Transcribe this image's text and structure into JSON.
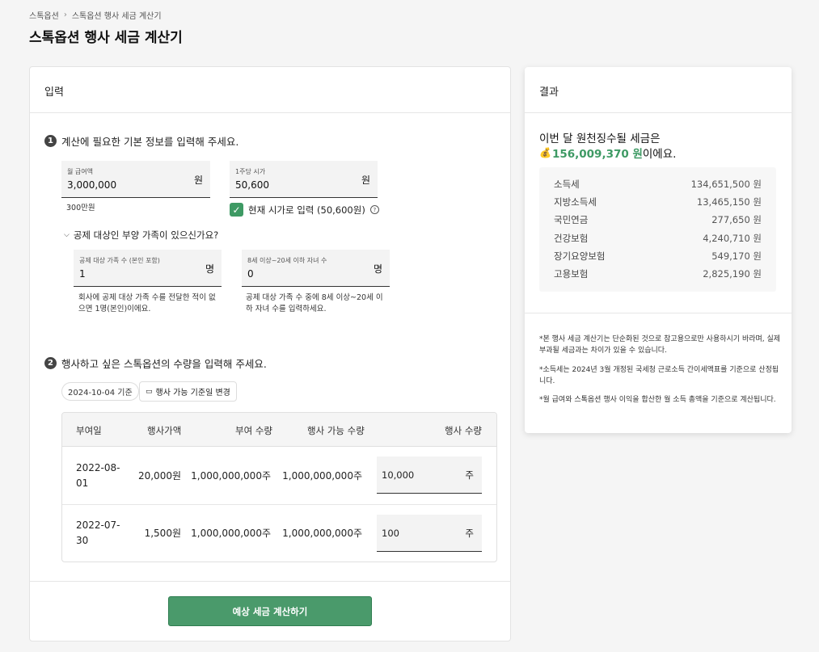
{
  "breadcrumb": {
    "parent": "스톡옵션",
    "current": "스톡옵션 행사 세금 계산기"
  },
  "title": "스톡옵션 행사 세금 계산기",
  "input_card": {
    "header": "입력",
    "step1": {
      "num": "1",
      "text": "계산에 필요한 기본 정보를 입력해 주세요."
    },
    "salary": {
      "label": "월 급여액",
      "value": "3,000,000",
      "unit": "원",
      "hint": "300만원"
    },
    "price": {
      "label": "1주당 시가",
      "value": "50,600",
      "unit": "원"
    },
    "current_price_check": {
      "label": "현재 시가로 입력 (50,600원)",
      "help": "?"
    },
    "dependents_toggle": "공제 대상인 부양 가족이 있으신가요?",
    "family": {
      "label": "공제 대상 가족 수 (본인 포함)",
      "value": "1",
      "unit": "명",
      "hint": "회사에 공제 대상 가족 수를 전달한 적이 없으면 1명(본인)이에요."
    },
    "children": {
      "label": "8세 이상~20세 이하 자녀 수",
      "value": "0",
      "unit": "명",
      "hint": "공제 대상 가족 수 중에 8세 이상~20세 이하 자녀 수를 입력하세요."
    },
    "step2": {
      "num": "2",
      "text": "행사하고 싶은 스톡옵션의 수량을 입력해 주세요."
    },
    "base_date": "2024-10-04 기준",
    "change_date_button": "행사 가능 기준일 변경",
    "table": {
      "headers": [
        "부여일",
        "행사가액",
        "부여 수량",
        "행사 가능 수량",
        "행사 수량"
      ],
      "rows": [
        {
          "date_line1": "2022-08-",
          "date_line2": "01",
          "price": "20,000원",
          "granted": "1,000,000,000주",
          "available": "1,000,000,000주",
          "qty": "10,000",
          "unit": "주"
        },
        {
          "date_line1": "2022-07-",
          "date_line2": "30",
          "price": "1,500원",
          "granted": "1,000,000,000주",
          "available": "1,000,000,000주",
          "qty": "100",
          "unit": "주"
        }
      ]
    },
    "submit": "예상 세금 계산하기"
  },
  "result_card": {
    "header": "결과",
    "line1": "이번 달 원천징수될 세금은",
    "amount": "156,009,370 원",
    "suffix": "이에요.",
    "breakdown": [
      {
        "label": "소득세",
        "value": "134,651,500 원"
      },
      {
        "label": "지방소득세",
        "value": "13,465,150 원"
      },
      {
        "label": "국민연금",
        "value": "277,650 원"
      },
      {
        "label": "건강보험",
        "value": "4,240,710 원"
      },
      {
        "label": "장기요양보험",
        "value": "549,170 원"
      },
      {
        "label": "고용보험",
        "value": "2,825,190 원"
      }
    ],
    "notes": [
      "*본 행사 세금 계산기는 단순화된 것으로 참고용으로만 사용하시기 바라며, 실제 부과될 세금과는 차이가 있을 수 있습니다.",
      "*소득세는 2024년 3월 개정된 국세청 근로소득 간이세액표를 기준으로 산정됩니다.",
      "*월 급여와 스톡옵션 행사 이익을 합산한 월 소득 총액을 기준으로 계산됩니다."
    ]
  }
}
